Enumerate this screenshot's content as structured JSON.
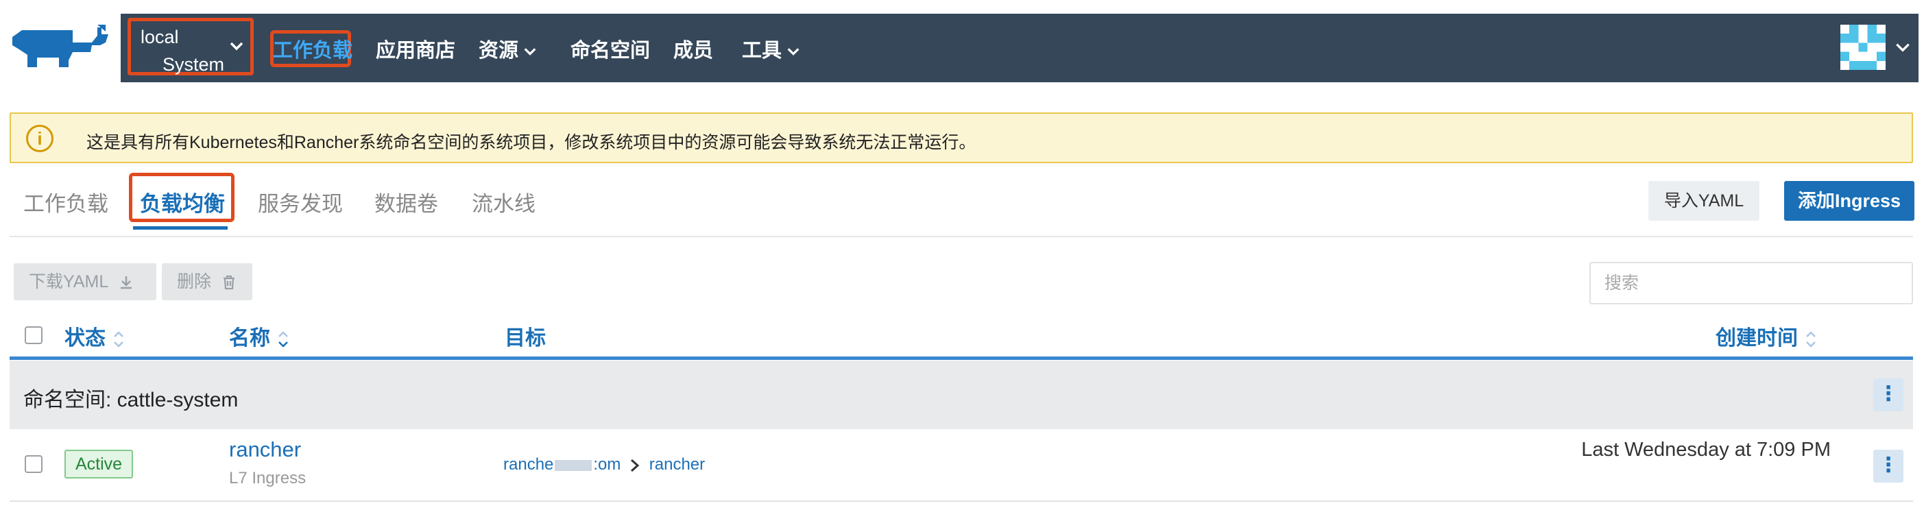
{
  "header": {
    "cluster": {
      "name": "local",
      "project": "System"
    },
    "nav": [
      {
        "label": "工作负载",
        "active": true,
        "dropdown": false
      },
      {
        "label": "应用商店",
        "active": false,
        "dropdown": false
      },
      {
        "label": "资源",
        "active": false,
        "dropdown": true
      },
      {
        "label": "命名空间",
        "active": false,
        "dropdown": false
      },
      {
        "label": "成员",
        "active": false,
        "dropdown": false
      },
      {
        "label": "工具",
        "active": false,
        "dropdown": true
      }
    ],
    "bg_color": "#354759",
    "active_color": "#3fa9f5",
    "highlight_color": "#e04a1f"
  },
  "banner": {
    "icon": "info-circle-icon",
    "text": "这是具有所有Kubernetes和Rancher系统命名空间的系统项目，修改系统项目中的资源可能会导致系统无法正常运行。"
  },
  "tabs": [
    {
      "label": "工作负载",
      "active": false
    },
    {
      "label": "负载均衡",
      "active": true
    },
    {
      "label": "服务发现",
      "active": false
    },
    {
      "label": "数据卷",
      "active": false
    },
    {
      "label": "流水线",
      "active": false
    }
  ],
  "actions": {
    "import_yaml": "导入YAML",
    "add_ingress": "添加Ingress"
  },
  "toolbar": {
    "download_yaml": "下载YAML",
    "delete": "删除",
    "search_placeholder": "搜索"
  },
  "table": {
    "columns": {
      "state": "状态",
      "name": "名称",
      "target": "目标",
      "created": "创建时间"
    },
    "group_label": "命名空间: cattle-system",
    "rows": [
      {
        "state": "Active",
        "name": "rancher",
        "type": "L7 Ingress",
        "target_host_start": "ranche",
        "target_host_end": ":om",
        "target_service": "rancher",
        "created": "Last Wednesday at 7:09 PM"
      }
    ]
  }
}
